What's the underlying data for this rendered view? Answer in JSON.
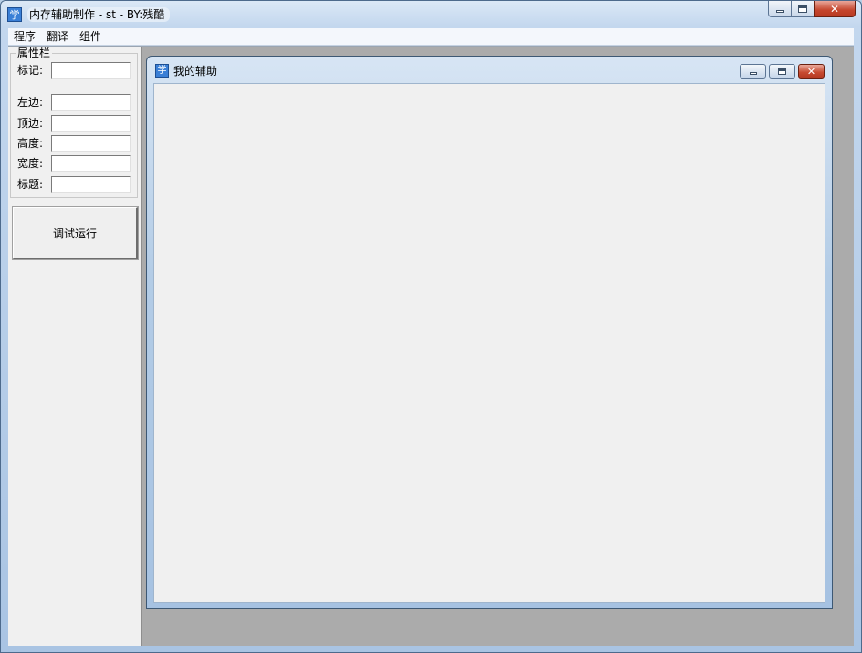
{
  "window": {
    "icon_glyph": "学",
    "title": "内存辅助制作 - st - BY:残酷",
    "buttons": {
      "minimize": "minimize-icon",
      "maximize": "maximize-icon",
      "close": "✕"
    }
  },
  "menubar": {
    "items": [
      "程序",
      "翻译",
      "组件"
    ]
  },
  "properties": {
    "group_title": "属性栏",
    "fields": [
      {
        "label": "标记:",
        "value": ""
      },
      {
        "label": "左边:",
        "value": ""
      },
      {
        "label": "顶边:",
        "value": ""
      },
      {
        "label": "高度:",
        "value": ""
      },
      {
        "label": "宽度:",
        "value": ""
      },
      {
        "label": "标题:",
        "value": ""
      }
    ]
  },
  "actions": {
    "run_label": "调试运行"
  },
  "inner_window": {
    "icon_glyph": "学",
    "title": "我的辅助",
    "close_glyph": "✕"
  },
  "colors": {
    "frame": "#b9cfe6",
    "client_bg": "#ababab",
    "panel_bg": "#f0f0f0",
    "close_red": "#c4452c",
    "icon_blue": "#3a7fd6"
  }
}
